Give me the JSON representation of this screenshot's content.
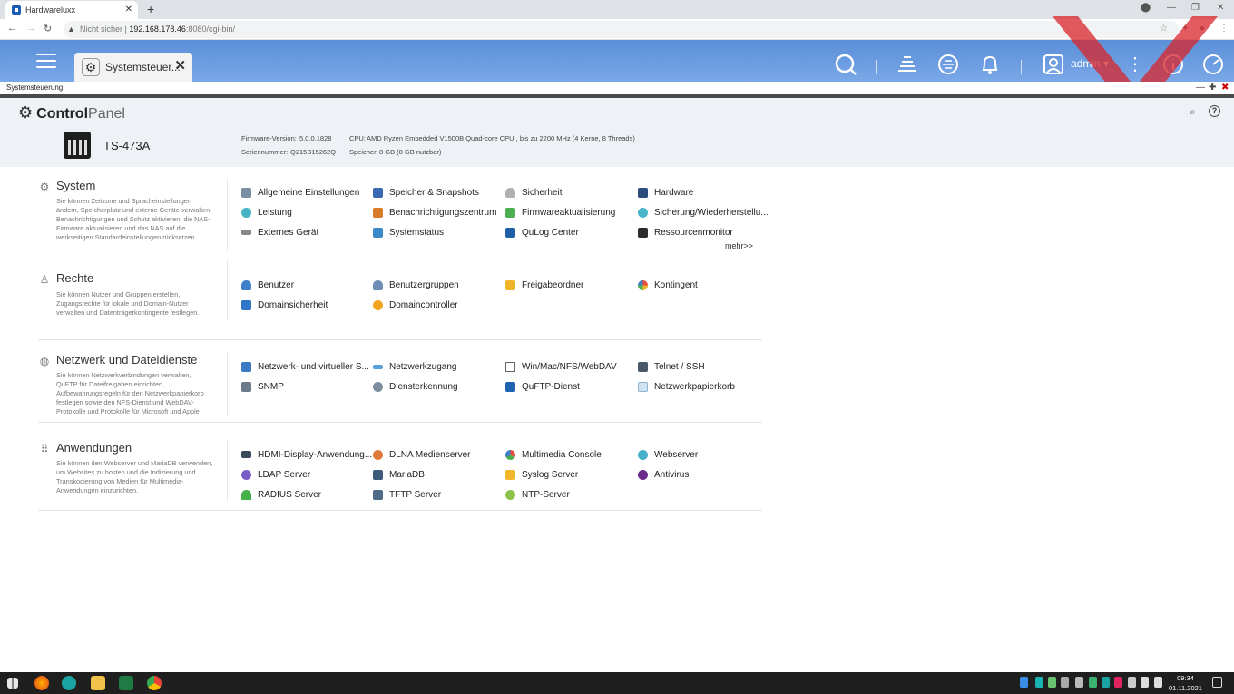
{
  "browser": {
    "tab_title": "Hardwareluxx",
    "tab_close": "✕",
    "new_tab": "+",
    "security_label": "Nicht sicher",
    "url_host": "192.168.178.46",
    "url_rest": ":8080/cgi-bin/"
  },
  "qts": {
    "app_tab_label": "Systemsteuer...",
    "app_tab_close": "✕",
    "user_name": "admin ▾",
    "window_title": "Systemsteuerung"
  },
  "controlpanel": {
    "title_bold": "Control",
    "title_light": "Panel",
    "model": "TS-473A",
    "firmware_label": "Firmware-Version:",
    "firmware_value": "5.0.0.1828",
    "serial_label": "Seriennummer:",
    "serial_value": "Q215B15262Q",
    "cpu_label": "CPU:",
    "cpu_value": "AMD Ryzen Embedded V1500B Quad-core CPU , bis zu 2200 MHz (4 Kerne, 8 Threads)",
    "memory_label": "Speicher:",
    "memory_value": "8 GB (8 GB nutzbar)",
    "more_label": "mehr>>"
  },
  "sections": [
    {
      "title": "System",
      "desc": [
        "Sie können Zeitzone und Spracheinstellungen",
        "ändern, Speicherplatz und externe Geräte verwalten,",
        "Benachrichtigungen und Schutz aktivieren, die NAS-",
        "Firmware aktualisieren und das NAS auf die",
        "werkseitigen Standardeinstellungen rücksetzen."
      ],
      "items": [
        "Allgemeine Einstellungen",
        "Speicher & Snapshots",
        "Sicherheit",
        "Hardware",
        "Leistung",
        "Benachrichtigungszentrum",
        "Firmwareaktualisierung",
        "Sicherung/Wiederherstellu...",
        "Externes Gerät",
        "Systemstatus",
        "QuLog Center",
        "Ressourcenmonitor"
      ]
    },
    {
      "title": "Rechte",
      "desc": [
        "Sie können Nutzer und Gruppen erstellen,",
        "Zugangsrechte für lokale und Domain-Nutzer",
        "verwalten und Datenträgerkontingente festlegen."
      ],
      "items": [
        "Benutzer",
        "Benutzergruppen",
        "Freigabeordner",
        "Kontingent",
        "Domainsicherheit",
        "Domaincontroller"
      ]
    },
    {
      "title": "Netzwerk und Dateidienste",
      "desc": [
        "Sie können Netzwerkverbindungen verwalten,",
        "QuFTP für Dateifreigaben einrichten,",
        "Aufbewahrungsregeln für den Netzwerkpapierkorb",
        "festlegen sowie den NFS-Dienst und WebDAV-",
        "Protokolle und Protokolle für Microsoft und Apple"
      ],
      "items": [
        "Netzwerk- und virtueller S...",
        "Netzwerkzugang",
        "Win/Mac/NFS/WebDAV",
        "Telnet / SSH",
        "SNMP",
        "Diensterkennung",
        "QuFTP-Dienst",
        "Netzwerkpapierkorb"
      ]
    },
    {
      "title": "Anwendungen",
      "desc": [
        "Sie können den Webserver und MariaDB verwenden,",
        "um Websites zu hosten und die Indizierung und",
        "Transkodierung von Medien für Multimedia-",
        "Anwendungen einzurichten."
      ],
      "items": [
        "HDMI-Display-Anwendung...",
        "DLNA Medienserver",
        "Multimedia Console",
        "Webserver",
        "LDAP Server",
        "MariaDB",
        "Syslog Server",
        "Antivirus",
        "RADIUS Server",
        "TFTP Server",
        "NTP-Server"
      ]
    }
  ],
  "taskbar": {
    "time": "09:34",
    "date": "01.11.2021"
  },
  "colors": {
    "header_blue": "#6b9de3",
    "watermark_red": "#d9252b"
  }
}
